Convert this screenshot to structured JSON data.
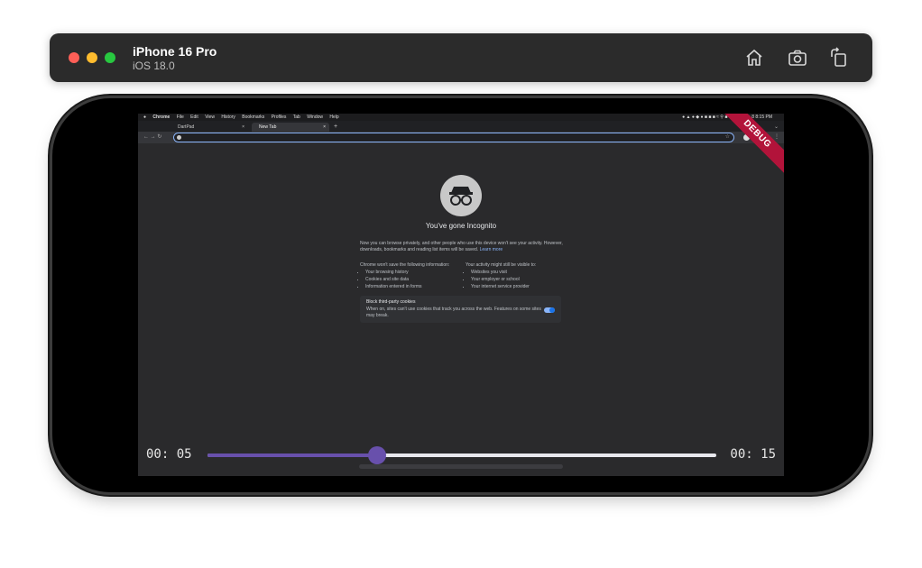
{
  "simulator": {
    "device_name": "iPhone 16 Pro",
    "os_version": "iOS 18.0",
    "buttons": [
      "home-icon",
      "screenshot-icon",
      "rotate-icon"
    ]
  },
  "debug_banner": "DEBUG",
  "menubar": {
    "items": [
      "Chrome",
      "File",
      "Edit",
      "View",
      "History",
      "Bookmarks",
      "Profiles",
      "Tab",
      "Window",
      "Help"
    ],
    "clock": "Thu Jan 8  8:15 PM"
  },
  "browser": {
    "tabs": [
      {
        "label": "DartPad"
      },
      {
        "label": "New Tab"
      }
    ],
    "incognito_label": "Incognito",
    "address_value": ""
  },
  "incognito_page": {
    "title": "You've gone Incognito",
    "description": "Now you can browse privately, and other people who use this device won't see your activity. However, downloads, bookmarks and reading list items will be saved.",
    "learn_more": "Learn more",
    "not_saved_heading": "Chrome won't save the following information:",
    "not_saved": [
      "Your browsing history",
      "Cookies and site data",
      "Information entered in forms"
    ],
    "visible_heading": "Your activity might still be visible to:",
    "visible": [
      "Websites you visit",
      "Your employer or school",
      "Your internet service provider"
    ],
    "cookie_title": "Block third-party cookies",
    "cookie_desc": "When on, sites can't use cookies that track you across the web. Features on some sites may break."
  },
  "player": {
    "current_time": "00: 05",
    "total_time": "00: 15",
    "progress": 0.333,
    "accent": "#6850ac"
  }
}
